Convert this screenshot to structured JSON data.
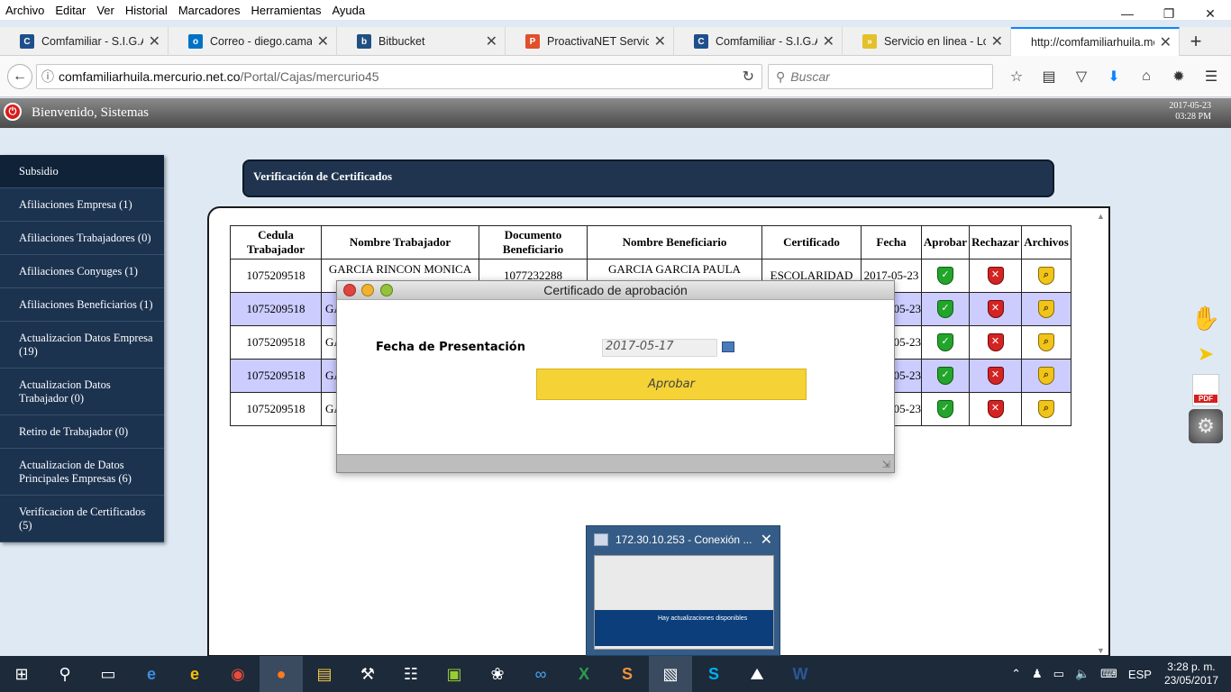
{
  "menu": [
    "Archivo",
    "Editar",
    "Ver",
    "Historial",
    "Marcadores",
    "Herramientas",
    "Ayuda"
  ],
  "tabs": [
    {
      "label": "Comfamiliar - S.I.G.A.S.",
      "icon": "sigas-icon",
      "color": "#1f4f8b",
      "glyph": "C"
    },
    {
      "label": "Correo - diego.camacho",
      "icon": "outlook-icon",
      "color": "#0072c6",
      "glyph": "o"
    },
    {
      "label": "Bitbucket",
      "icon": "bitbucket-icon",
      "color": "#205081",
      "glyph": "b"
    },
    {
      "label": "ProactivaNET Service Desk",
      "icon": "proactivanet-icon",
      "color": "#e0502a",
      "glyph": "P"
    },
    {
      "label": "Comfamiliar - S.I.G.A.S.",
      "icon": "sigas-icon",
      "color": "#1f4f8b",
      "glyph": "C"
    },
    {
      "label": "Servicio en linea - Login",
      "icon": "wing-icon",
      "color": "#e4c02a",
      "glyph": "»"
    },
    {
      "label": "http://comfamiliarhuila.mercurio.net.co",
      "icon": "none",
      "color": "#ffffff",
      "glyph": ""
    }
  ],
  "url": {
    "host": "comfamiliarhuila.mercurio.net.co",
    "path": "/Portal/Cajas/mercurio45"
  },
  "search": {
    "placeholder": "Buscar"
  },
  "header": {
    "welcome": "Bienvenido, Sistemas",
    "date": "2017-05-23",
    "time": "03:28 PM"
  },
  "sidebar": {
    "items": [
      "Subsidio",
      "Afiliaciones Empresa (1)",
      "Afiliaciones Trabajadores (0)",
      "Afiliaciones Conyuges (1)",
      "Afiliaciones Beneficiarios (1)",
      "Actualizacion Datos Empresa (19)",
      "Actualizacion Datos Trabajador (0)",
      "Retiro de Trabajador (0)",
      "Actualizacion de Datos Principales Empresas (6)",
      "Verificacion de Certificados (5)"
    ]
  },
  "section_title": "Verificación de Certificados",
  "table": {
    "headers": [
      "Cedula Trabajador",
      "Nombre Trabajador",
      "Documento Beneficiario",
      "Nombre Beneficiario",
      "Certificado",
      "Fecha",
      "Aprobar",
      "Rechazar",
      "Archivos"
    ],
    "rows": [
      {
        "cedula": "1075209518",
        "nombre": "GARCIA RINCON MONICA",
        "documento": "1077232288",
        "beneficiario": "GARCIA GARCIA PAULA",
        "certificado": "ESCOLARIDAD",
        "fecha": "2017-05-23"
      },
      {
        "cedula": "1075209518",
        "nombre": "GA",
        "documento": "",
        "beneficiario": "",
        "certificado": "",
        "fecha": "05-23"
      },
      {
        "cedula": "1075209518",
        "nombre": "GA",
        "documento": "",
        "beneficiario": "",
        "certificado": "",
        "fecha": "05-23"
      },
      {
        "cedula": "1075209518",
        "nombre": "GA",
        "documento": "",
        "beneficiario": "",
        "certificado": "",
        "fecha": "05-23"
      },
      {
        "cedula": "1075209518",
        "nombre": "GA",
        "documento": "",
        "beneficiario": "",
        "certificado": "",
        "fecha": "05-23"
      }
    ]
  },
  "modal": {
    "title": "Certificado de aprobación",
    "date_label": "Fecha de Presentación",
    "date_value": "2017-05-17",
    "approve_label": "Aprobar"
  },
  "right_icons": [
    "hands-icon",
    "wing-icon",
    "pdf-icon",
    "gear-icon"
  ],
  "pdf_text": "PDF",
  "thumbnail": {
    "title": "172.30.10.253 - Conexión ...",
    "message": "Hay actualizaciones disponibles"
  },
  "taskbar": {
    "lang": "ESP",
    "time": "3:28 p. m.",
    "date": "23/05/2017"
  }
}
